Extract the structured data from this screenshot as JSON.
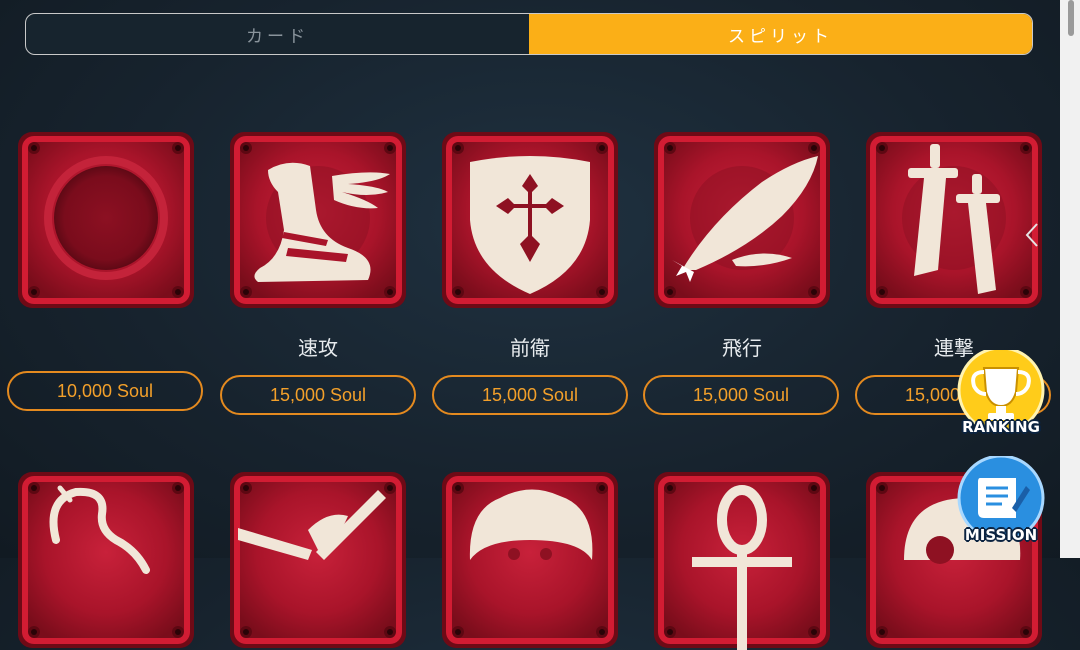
{
  "tabs": [
    {
      "label": "カード",
      "active": false
    },
    {
      "label": "スピリット",
      "active": true
    }
  ],
  "spirits_row1": [
    {
      "name": "",
      "price": "10,000 Soul",
      "icon": "empty-circle-icon"
    },
    {
      "name": "速攻",
      "price": "15,000 Soul",
      "icon": "winged-boot-icon"
    },
    {
      "name": "前衛",
      "price": "15,000 Soul",
      "icon": "shield-cross-icon"
    },
    {
      "name": "飛行",
      "price": "15,000 Soul",
      "icon": "feather-icon"
    },
    {
      "name": "連撃",
      "price": "15,000 Soul",
      "icon": "twin-swords-icon"
    }
  ],
  "spirits_row2": [
    {
      "icon": "scorpion-icon"
    },
    {
      "icon": "sword-icon"
    },
    {
      "icon": "lion-mane-icon"
    },
    {
      "icon": "ankh-icon"
    },
    {
      "icon": "skull-icon"
    }
  ],
  "floating_buttons": {
    "ranking": {
      "label": "RANKING",
      "icon": "trophy-icon"
    },
    "mission": {
      "label": "MISSION",
      "icon": "scroll-icon"
    }
  },
  "colors": {
    "accent": "#fbaf17",
    "price_border": "#e48a1f",
    "card_red": "#b5172c",
    "card_frame": "#8c0f1e",
    "ranking_yellow": "#ffcc1a",
    "mission_blue": "#2a8fe0"
  }
}
